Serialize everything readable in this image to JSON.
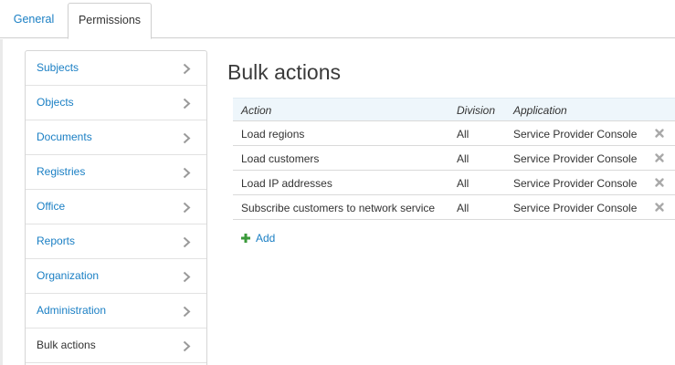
{
  "tabs": [
    {
      "label": "General"
    },
    {
      "label": "Permissions"
    }
  ],
  "sidebar": {
    "items": [
      {
        "label": "Subjects"
      },
      {
        "label": "Objects"
      },
      {
        "label": "Documents"
      },
      {
        "label": "Registries"
      },
      {
        "label": "Office"
      },
      {
        "label": "Reports"
      },
      {
        "label": "Organization"
      },
      {
        "label": "Administration"
      },
      {
        "label": "Bulk actions"
      }
    ],
    "active_item": "Bulk actions"
  },
  "main": {
    "title": "Bulk actions",
    "columns": [
      "Action",
      "Division",
      "Application"
    ],
    "rows": [
      {
        "action": "Load regions",
        "division": "All",
        "application": "Service Provider Console"
      },
      {
        "action": "Load customers",
        "division": "All",
        "application": "Service Provider Console"
      },
      {
        "action": "Load IP addresses",
        "division": "All",
        "application": "Service Provider Console"
      },
      {
        "action": "Subscribe customers to network service",
        "division": "All",
        "application": "Service Provider Console"
      }
    ],
    "add_label": "Add"
  },
  "colors": {
    "link": "#1a7fc4",
    "header_bg": "#eef6fb",
    "add_icon": "#3a9a3a",
    "delete_icon": "#a9a9a9"
  },
  "icons": {
    "sidebar_chevron": "chevron-right-icon",
    "row_delete": "close-icon",
    "add": "plus-icon"
  }
}
